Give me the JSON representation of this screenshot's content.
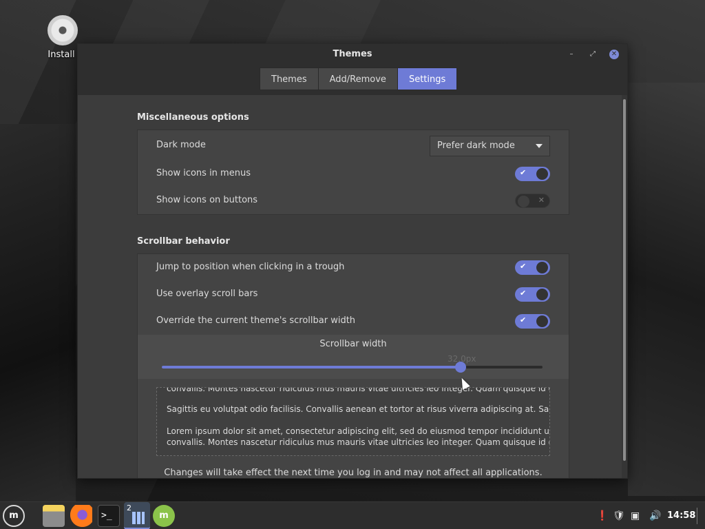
{
  "desktop": {
    "icon_label": "Install"
  },
  "window": {
    "title": "Themes",
    "tabs": [
      {
        "label": "Themes",
        "active": false
      },
      {
        "label": "Add/Remove",
        "active": false
      },
      {
        "label": "Settings",
        "active": true
      }
    ]
  },
  "misc": {
    "title": "Miscellaneous options",
    "dark_mode": {
      "label": "Dark mode",
      "value": "Prefer dark mode"
    },
    "show_icons_menus": {
      "label": "Show icons in menus",
      "on": true
    },
    "show_icons_buttons": {
      "label": "Show icons on buttons",
      "on": false
    }
  },
  "scrollbar": {
    "title": "Scrollbar behavior",
    "jump": {
      "label": "Jump to position when clicking in a trough",
      "on": true
    },
    "overlay": {
      "label": "Use overlay scroll bars",
      "on": true
    },
    "override": {
      "label": "Override the current theme's scrollbar width",
      "on": true
    },
    "width": {
      "label": "Scrollbar width",
      "value_text": "32.0px",
      "fraction": 0.785
    }
  },
  "preview": {
    "line0": "convallis. Montes nascetur ridiculus mus mauris vitae ultricies leo integer. Quam quisque id diam",
    "line1": "Sagittis eu volutpat odio facilisis. Convallis aenean et tortor at risus viverra adipiscing at. Sapien",
    "line2": "Lorem ipsum dolor sit amet, consectetur adipiscing elit, sed do eiusmod tempor incididunt ut labore",
    "line3": "convallis. Montes nascetur ridiculus mus mauris vitae ultricies leo integer. Quam quisque id diam"
  },
  "footer_note": "Changes will take effect the next time you log in and may not affect all applications.",
  "taskbar": {
    "workspace_number": "2",
    "terminal_glyph": ">_",
    "clock": "14:58",
    "icons": [
      "menu-icon",
      "files-icon",
      "firefox-icon",
      "terminal-icon",
      "themes-icon",
      "update-manager-icon"
    ],
    "tray_icons": [
      "notification-icon",
      "shield-icon",
      "network-icon",
      "volume-icon"
    ]
  },
  "colors": {
    "accent": "#6e7bd6",
    "window_bg": "#3c3c3c",
    "panel_bg": "#444444",
    "titlebar_bg": "#2e2e2e"
  }
}
